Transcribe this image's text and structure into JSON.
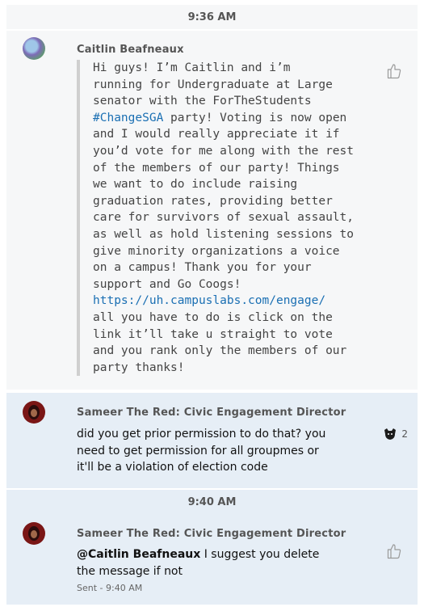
{
  "dividers": [
    "9:36 AM",
    "9:40 AM"
  ],
  "messages": [
    {
      "sender": "Caitlin Beafneaux",
      "lines": [
        "Hi guys! I’m Caitlin and i’m",
        "running for Undergraduate at Large",
        "senator with the ForTheStudents",
        "party! Voting is now open",
        "and I would really appreciate it if",
        "you’d vote for me along with the rest",
        "of the members of our party! Things",
        "we want to do include raising",
        "graduation rates, providing better",
        "care for survivors of sexual assault,",
        "as well as hold listening sessions to",
        "give minority organizations a voice",
        "on a campus! Thank you for your",
        "support and Go Coogs!",
        "",
        "all you have to do is click on the",
        "link it’ll take u straight to vote",
        "and you rank only the members of our",
        "party thanks!"
      ],
      "hashtag": "#ChangeSGA",
      "link": "https://uh.campuslabs.com/engage/",
      "like_icon": "thumbs-up-outline-icon"
    },
    {
      "sender": "Sameer The Red: Civic Engagement Director",
      "text": "did you get prior permission to do that? you need to get permission for all groupmes or it'll be a violation of election code",
      "reaction_icon": "cougar-emoji-icon",
      "reaction_count": "2"
    },
    {
      "sender": "Sameer The Red: Civic Engagement Director",
      "mention": "@Caitlin Beafneaux",
      "text": " I suggest you delete the message if not",
      "status": "Sent - 9:40 AM",
      "like_icon": "thumbs-up-outline-icon"
    }
  ],
  "colors": {
    "link": "#1a6fb3",
    "highlight_bg": "#e6eef6",
    "plain_bg": "#f6f7f8"
  }
}
